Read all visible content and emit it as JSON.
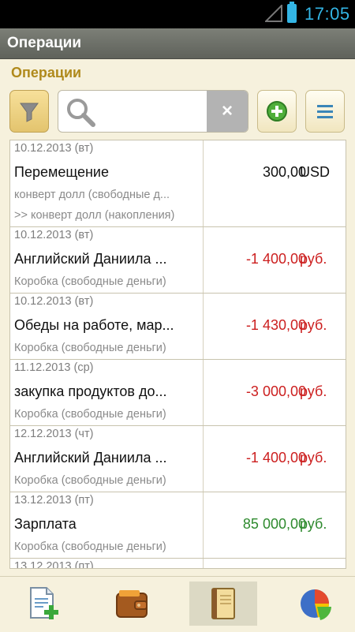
{
  "status": {
    "time": "17:05"
  },
  "actionbar": {
    "title": "Операции"
  },
  "page": {
    "heading": "Операции"
  },
  "search": {
    "value": "",
    "clear_label": "×"
  },
  "operations": [
    {
      "date": "10.12.2013 (вт)",
      "name": "Перемещение",
      "account": "конверт долл (свободные д...",
      "account2": ">> конверт долл (накопления)",
      "amount": "300,00",
      "currency": "USD",
      "color": "#111111"
    },
    {
      "date": "10.12.2013 (вт)",
      "name": "Английский Даниила ...",
      "account": "Коробка (свободные деньги)",
      "amount": "-1 400,00",
      "currency": "руб.",
      "color": "#cc1f1f"
    },
    {
      "date": "10.12.2013 (вт)",
      "name": "Обеды на работе, мар...",
      "account": "Коробка (свободные деньги)",
      "amount": "-1 430,00",
      "currency": "руб.",
      "color": "#cc1f1f"
    },
    {
      "date": "11.12.2013 (ср)",
      "name": "закупка продуктов до...",
      "account": "Коробка (свободные деньги)",
      "amount": "-3 000,00",
      "currency": "руб.",
      "color": "#cc1f1f"
    },
    {
      "date": "12.12.2013 (чт)",
      "name": "Английский Даниила ...",
      "account": "Коробка (свободные деньги)",
      "amount": "-1 400,00",
      "currency": "руб.",
      "color": "#cc1f1f"
    },
    {
      "date": "13.12.2013 (пт)",
      "name": "Зарплата",
      "account": "Коробка (свободные деньги)",
      "amount": "85 000,00",
      "currency": "руб.",
      "color": "#2e8a2e"
    },
    {
      "date": "13.12.2013 (пт)"
    }
  ],
  "icons": {
    "filter": "filter-icon",
    "search": "search-icon",
    "add": "add-icon",
    "menu": "menu-icon",
    "nav": [
      "new-document-icon",
      "wallet-icon",
      "journal-icon",
      "pie-chart-icon"
    ]
  }
}
